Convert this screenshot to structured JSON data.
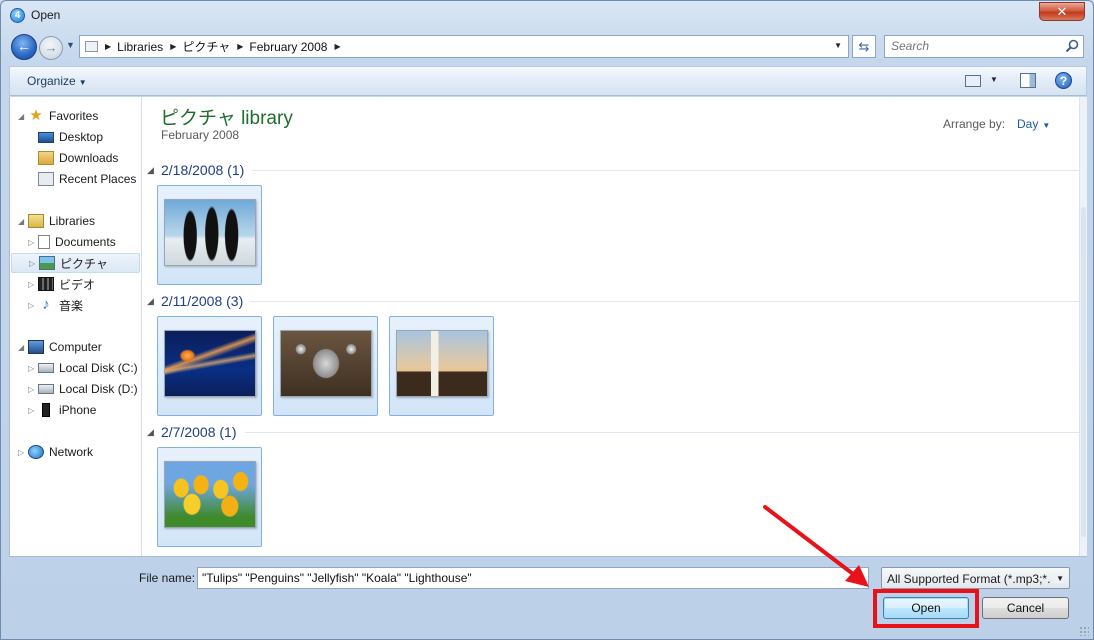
{
  "window": {
    "title": "Open",
    "close_glyph": "✕"
  },
  "address": {
    "breadcrumbs": [
      "Libraries",
      "ピクチャ",
      "February 2008"
    ],
    "search_placeholder": "Search"
  },
  "toolbar": {
    "organize_label": "Organize"
  },
  "sidebar": {
    "favorites": {
      "label": "Favorites",
      "items": [
        "Desktop",
        "Downloads",
        "Recent Places"
      ]
    },
    "libraries": {
      "label": "Libraries",
      "items": [
        "Documents",
        "ピクチャ",
        "ビデオ",
        "音楽"
      ],
      "selected": "ピクチャ"
    },
    "computer": {
      "label": "Computer",
      "items": [
        "Local Disk (C:)",
        "Local Disk (D:)",
        "iPhone"
      ]
    },
    "network": {
      "label": "Network"
    }
  },
  "library": {
    "title": "ピクチャ library",
    "subtitle": "February 2008",
    "arrange_label": "Arrange by:",
    "arrange_value": "Day"
  },
  "groups": [
    {
      "label": "2/18/2008 (1)",
      "photos": [
        "Penguins"
      ]
    },
    {
      "label": "2/11/2008 (3)",
      "photos": [
        "Jellyfish",
        "Koala",
        "Lighthouse"
      ]
    },
    {
      "label": "2/7/2008 (1)",
      "photos": [
        "Tulips"
      ]
    }
  ],
  "footer": {
    "filename_label": "File name:",
    "filename_value": "\"Tulips\" \"Penguins\" \"Jellyfish\" \"Koala\" \"Lighthouse\"",
    "filetype_value": "All Supported Format (*.mp3;*.",
    "open_label": "Open",
    "cancel_label": "Cancel"
  },
  "colors": {
    "annotation_red": "#e8121b",
    "library_title": "#1e6e2e",
    "group_header": "#1e3e86"
  }
}
